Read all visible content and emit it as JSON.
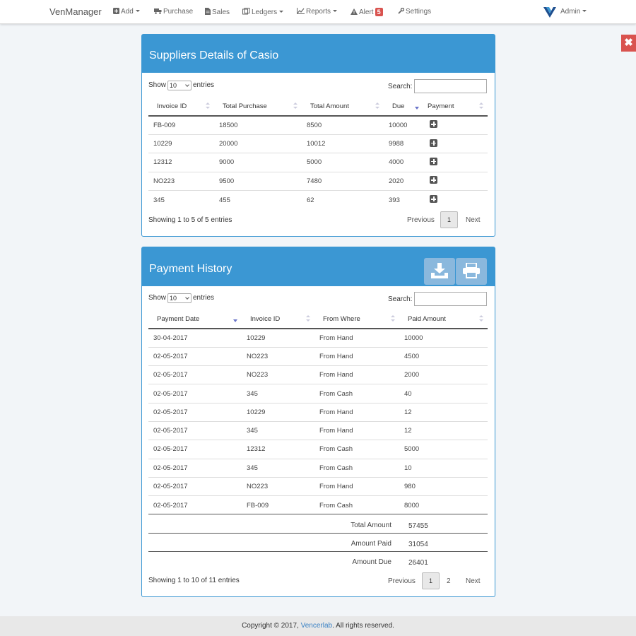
{
  "navbar": {
    "brand": "VenManager",
    "items": [
      {
        "label": "Add",
        "icon": "plus-square-icon"
      },
      {
        "label": "Purchase",
        "icon": "truck-icon"
      },
      {
        "label": "Sales",
        "icon": "file-icon"
      },
      {
        "label": "Ledgers",
        "icon": "book-icon"
      },
      {
        "label": "Reports",
        "icon": "line-chart-icon"
      },
      {
        "label": "Alert",
        "icon": "warning-icon",
        "badge": "5"
      },
      {
        "label": "Settings",
        "icon": "wrench-icon"
      }
    ],
    "user": "Admin"
  },
  "suppliers_panel": {
    "title": "Suppliers Details of Casio",
    "show_label": "Show",
    "entries_label": "entries",
    "page_size": "10",
    "search_label": "Search:",
    "columns": [
      "Invoice ID",
      "Total Purchase",
      "Total Amount",
      "Due",
      "Payment"
    ],
    "rows": [
      [
        "FB-009",
        "18500",
        "8500",
        "10000"
      ],
      [
        "10229",
        "20000",
        "10012",
        "9988"
      ],
      [
        "12312",
        "9000",
        "5000",
        "4000"
      ],
      [
        "NO223",
        "9500",
        "7480",
        "2020"
      ],
      [
        "345",
        "455",
        "62",
        "393"
      ]
    ],
    "info": "Showing 1 to 5 of 5 entries",
    "pagination": {
      "previous": "Previous",
      "pages": [
        "1"
      ],
      "next": "Next"
    }
  },
  "payment_panel": {
    "title": "Payment History",
    "show_label": "Show",
    "entries_label": "entries",
    "page_size": "10",
    "search_label": "Search:",
    "columns": [
      "Payment Date",
      "Invoice ID",
      "From Where",
      "Paid Amount"
    ],
    "rows": [
      [
        "30-04-2017",
        "10229",
        "From Hand",
        "10000"
      ],
      [
        "02-05-2017",
        "NO223",
        "From Hand",
        "4500"
      ],
      [
        "02-05-2017",
        "NO223",
        "From Hand",
        "2000"
      ],
      [
        "02-05-2017",
        "345",
        "From Cash",
        "40"
      ],
      [
        "02-05-2017",
        "10229",
        "From Hand",
        "12"
      ],
      [
        "02-05-2017",
        "345",
        "From Hand",
        "12"
      ],
      [
        "02-05-2017",
        "12312",
        "From Cash",
        "5000"
      ],
      [
        "02-05-2017",
        "345",
        "From Cash",
        "10"
      ],
      [
        "02-05-2017",
        "NO223",
        "From Hand",
        "980"
      ],
      [
        "02-05-2017",
        "FB-009",
        "From Cash",
        "8000"
      ]
    ],
    "totals": {
      "total_amount_label": "Total Amount",
      "total_amount": "57455",
      "amount_paid_label": "Amount Paid",
      "amount_paid": "31054",
      "amount_due_label": "Amount Due",
      "amount_due": "26401"
    },
    "info": "Showing 1 to 10 of 11 entries",
    "pagination": {
      "previous": "Previous",
      "pages": [
        "1",
        "2"
      ],
      "next": "Next"
    }
  },
  "footer": {
    "prefix": "Copyright © 2017,",
    "link": "Vencerlab",
    "suffix": ". All rights reserved."
  },
  "colors": {
    "primary": "#3b97d3",
    "danger": "#d9534f"
  }
}
